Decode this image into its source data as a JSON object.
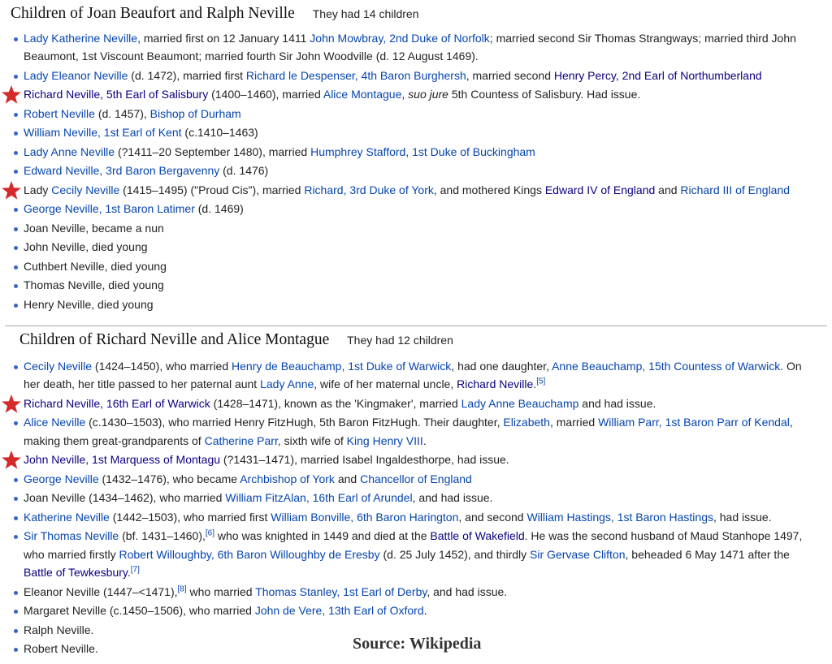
{
  "section1": {
    "title": "Children of Joan Beaufort and Ralph Neville",
    "subtitle": "They had 14 children",
    "items": [
      {
        "starred": false,
        "parts": [
          {
            "t": "Lady Katherine Neville",
            "link": true
          },
          {
            "t": ", married first on 12 January 1411 "
          },
          {
            "t": "John Mowbray, 2nd Duke of Norfolk",
            "link": true
          },
          {
            "t": "; married second Sir Thomas Strangways; married third John Beaumont, 1st Viscount Beaumont; married fourth Sir John Woodville (d. 12 August 1469)."
          }
        ]
      },
      {
        "starred": false,
        "parts": [
          {
            "t": "Lady Eleanor Neville",
            "link": true
          },
          {
            "t": " (d. 1472), married first "
          },
          {
            "t": "Richard le Despenser, 4th Baron Burghersh",
            "link": true
          },
          {
            "t": ", married second "
          },
          {
            "t": "Henry Percy, 2nd Earl of Northumberland",
            "link": "dark"
          }
        ]
      },
      {
        "starred": true,
        "parts": [
          {
            "t": "Richard Neville, 5th Earl of Salisbury",
            "link": "dark"
          },
          {
            "t": " (1400–1460), married "
          },
          {
            "t": "Alice Montague",
            "link": true
          },
          {
            "t": ", "
          },
          {
            "t": "suo jure",
            "italic": true
          },
          {
            "t": " 5th Countess of Salisbury. Had issue."
          }
        ]
      },
      {
        "starred": false,
        "parts": [
          {
            "t": "Robert Neville",
            "link": true
          },
          {
            "t": " (d. 1457), "
          },
          {
            "t": "Bishop of Durham",
            "link": true
          }
        ]
      },
      {
        "starred": false,
        "parts": [
          {
            "t": "William Neville, 1st Earl of Kent",
            "link": true
          },
          {
            "t": " (c.1410–1463)"
          }
        ]
      },
      {
        "starred": false,
        "parts": [
          {
            "t": "Lady Anne Neville",
            "link": true
          },
          {
            "t": " (?1411–20 September 1480), married "
          },
          {
            "t": "Humphrey Stafford, 1st Duke of Buckingham",
            "link": true
          }
        ]
      },
      {
        "starred": false,
        "parts": [
          {
            "t": "Edward Neville, 3rd Baron Bergavenny",
            "link": true
          },
          {
            "t": " (d. 1476)"
          }
        ]
      },
      {
        "starred": true,
        "parts": [
          {
            "t": "Lady "
          },
          {
            "t": "Cecily Neville",
            "link": true
          },
          {
            "t": " (1415–1495) (\"Proud Cis\"), married "
          },
          {
            "t": "Richard, 3rd Duke of York",
            "link": true
          },
          {
            "t": ", and mothered Kings "
          },
          {
            "t": "Edward IV of England",
            "link": "dark"
          },
          {
            "t": " and "
          },
          {
            "t": "Richard III of England",
            "link": true
          }
        ]
      },
      {
        "starred": false,
        "parts": [
          {
            "t": "George Neville, 1st Baron Latimer",
            "link": true
          },
          {
            "t": " (d. 1469)"
          }
        ]
      },
      {
        "starred": false,
        "parts": [
          {
            "t": "Joan Neville, became a nun"
          }
        ]
      },
      {
        "starred": false,
        "parts": [
          {
            "t": "John Neville, died young"
          }
        ]
      },
      {
        "starred": false,
        "parts": [
          {
            "t": "Cuthbert Neville, died young"
          }
        ]
      },
      {
        "starred": false,
        "parts": [
          {
            "t": "Thomas Neville, died young"
          }
        ]
      },
      {
        "starred": false,
        "parts": [
          {
            "t": "Henry Neville, died young"
          }
        ]
      }
    ]
  },
  "section2": {
    "title": "Children of Richard Neville and Alice Montague",
    "subtitle": "They had 12 children",
    "items": [
      {
        "starred": false,
        "parts": [
          {
            "t": "Cecily Neville",
            "link": true
          },
          {
            "t": " (1424–1450), who married "
          },
          {
            "t": "Henry de Beauchamp, 1st Duke of Warwick",
            "link": true
          },
          {
            "t": ", had one daughter, "
          },
          {
            "t": "Anne Beauchamp, 15th Countess of Warwick",
            "link": true
          },
          {
            "t": ". On her death, her title passed to her paternal aunt "
          },
          {
            "t": "Lady Anne",
            "link": true
          },
          {
            "t": ", wife of her maternal uncle, "
          },
          {
            "t": "Richard Neville",
            "link": "dark"
          },
          {
            "t": ".",
            "end": true
          },
          {
            "t": "[5]",
            "sup": true
          }
        ]
      },
      {
        "starred": true,
        "parts": [
          {
            "t": "Richard Neville, 16th Earl of Warwick",
            "link": "dark"
          },
          {
            "t": " (1428–1471), known as the 'Kingmaker', married "
          },
          {
            "t": "Lady Anne Beauchamp",
            "link": true
          },
          {
            "t": " and had issue."
          }
        ]
      },
      {
        "starred": false,
        "parts": [
          {
            "t": "Alice Neville",
            "link": true
          },
          {
            "t": " (c.1430–1503), who married Henry FitzHugh, 5th Baron FitzHugh. Their daughter, "
          },
          {
            "t": "Elizabeth",
            "link": true
          },
          {
            "t": ", married "
          },
          {
            "t": "William Parr, 1st Baron Parr of Kendal",
            "link": true
          },
          {
            "t": ", making them great-grandparents of "
          },
          {
            "t": "Catherine Parr",
            "link": true
          },
          {
            "t": ", sixth wife of "
          },
          {
            "t": "King Henry VIII",
            "link": true
          },
          {
            "t": "."
          }
        ]
      },
      {
        "starred": true,
        "parts": [
          {
            "t": "John Neville, 1st Marquess of Montagu",
            "link": "dark"
          },
          {
            "t": " (?1431–1471), married Isabel Ingaldesthorpe, had issue."
          }
        ]
      },
      {
        "starred": false,
        "parts": [
          {
            "t": "George Neville",
            "link": true
          },
          {
            "t": " (1432–1476), who became "
          },
          {
            "t": "Archbishop of York",
            "link": true
          },
          {
            "t": " and "
          },
          {
            "t": "Chancellor of England",
            "link": true
          }
        ]
      },
      {
        "starred": false,
        "parts": [
          {
            "t": "Joan Neville (1434–1462), who married "
          },
          {
            "t": "William FitzAlan, 16th Earl of Arundel",
            "link": true
          },
          {
            "t": ", and had issue."
          }
        ]
      },
      {
        "starred": false,
        "parts": [
          {
            "t": "Katherine Neville",
            "link": true
          },
          {
            "t": " (1442–1503), who married first "
          },
          {
            "t": "William Bonville, 6th Baron Harington",
            "link": true
          },
          {
            "t": ", and second "
          },
          {
            "t": "William Hastings, 1st Baron Hastings",
            "link": true
          },
          {
            "t": ", had issue."
          }
        ]
      },
      {
        "starred": false,
        "parts": [
          {
            "t": "Sir Thomas Neville",
            "link": true
          },
          {
            "t": " (bf. 1431–1460),"
          },
          {
            "t": "[6]",
            "sup": true
          },
          {
            "t": " who was knighted in 1449 and died at the "
          },
          {
            "t": "Battle of Wakefield",
            "link": "dark"
          },
          {
            "t": ". He was the second husband of Maud Stanhope 1497, who married firstly "
          },
          {
            "t": "Robert Willoughby, 6th Baron Willoughby de Eresby",
            "link": true
          },
          {
            "t": " (d. 25 July 1452), and thirdly "
          },
          {
            "t": "Sir Gervase Clifton",
            "link": true
          },
          {
            "t": ", beheaded 6 May 1471 after the "
          },
          {
            "t": "Battle of Tewkesbury",
            "link": "dark"
          },
          {
            "t": ".",
            "end": true
          },
          {
            "t": "[7]",
            "sup": true
          }
        ]
      },
      {
        "starred": false,
        "parts": [
          {
            "t": "Eleanor Neville (1447–<1471),"
          },
          {
            "t": "[8]",
            "sup": true
          },
          {
            "t": " who married "
          },
          {
            "t": "Thomas Stanley, 1st Earl of Derby",
            "link": true
          },
          {
            "t": ", and had issue."
          }
        ]
      },
      {
        "starred": false,
        "parts": [
          {
            "t": "Margaret Neville (c.1450–1506), who married "
          },
          {
            "t": "John de Vere, 13th Earl of Oxford",
            "link": true
          },
          {
            "t": "."
          }
        ]
      },
      {
        "starred": false,
        "parts": [
          {
            "t": "Ralph Neville."
          }
        ]
      },
      {
        "starred": false,
        "parts": [
          {
            "t": "Robert Neville."
          }
        ]
      }
    ]
  },
  "source": "Source: Wikipedia",
  "colors": {
    "link": "#0645ad",
    "visited": "#0b0080",
    "star": "#d42a2a",
    "bullet": "#3366cc"
  },
  "icons": {
    "star": "red-star-icon",
    "bullet": "bullet-icon"
  }
}
